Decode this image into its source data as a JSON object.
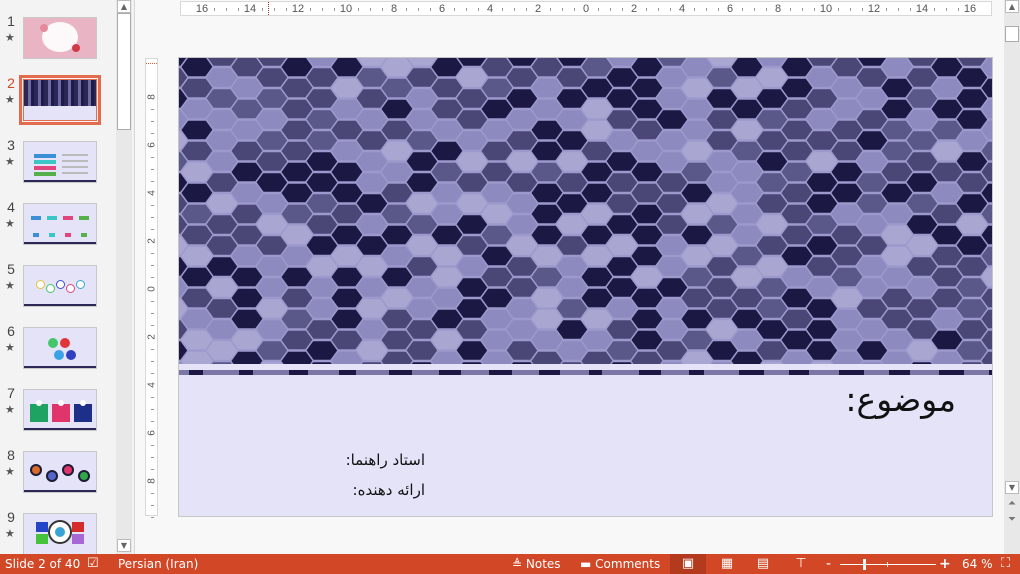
{
  "thumbnails": {
    "items": [
      {
        "number": "1",
        "bg": "#e9b4c3",
        "accent": "#ffffff",
        "kind": "floral"
      },
      {
        "number": "2",
        "bg": "#4a4777",
        "accent": "#e4e3f7",
        "kind": "hex",
        "active": true
      },
      {
        "number": "3",
        "bg": "#e4e3f7",
        "accent": "#3aa3d6",
        "kind": "list"
      },
      {
        "number": "4",
        "bg": "#e4e3f7",
        "accent": "#3aa3d6",
        "kind": "columns"
      },
      {
        "number": "5",
        "bg": "#e4e3f7",
        "accent": "#e3c13b",
        "kind": "circles"
      },
      {
        "number": "6",
        "bg": "#e4e3f7",
        "accent": "#44c76b",
        "kind": "hexes"
      },
      {
        "number": "7",
        "bg": "#e4e3f7",
        "accent": "#1ea363",
        "kind": "cards"
      },
      {
        "number": "8",
        "bg": "#e4e3f7",
        "accent": "#1d1b35",
        "kind": "wave"
      },
      {
        "number": "9",
        "bg": "#e4e3f7",
        "accent": "#2545c8",
        "kind": "target"
      }
    ],
    "star_icon": "★"
  },
  "ruler": {
    "horizontal_labels": [
      "16",
      "14",
      "12",
      "10",
      "8",
      "6",
      "4",
      "2",
      "0",
      "2",
      "4",
      "6",
      "8",
      "10",
      "12",
      "14",
      "16"
    ],
    "vertical_labels": [
      "8",
      "6",
      "4",
      "2",
      "0",
      "2",
      "4",
      "6",
      "8"
    ]
  },
  "slide": {
    "title": "موضوع:",
    "advisor_label": "استاد راهنما:",
    "presenter_label": "ارائه دهنده:",
    "colors": {
      "dark": "#1b1843",
      "mid": "#4a4777",
      "light": "#8d8ac0",
      "lighter": "#a9a6d2",
      "background": "#e4e3f7"
    }
  },
  "status_bar": {
    "slide_indicator": "Slide 2 of 40",
    "language": "Persian (Iran)",
    "notes_label": "Notes",
    "comments_label": "Comments",
    "zoom_level": "64 %",
    "zoom_fraction": 0.5,
    "color": "#d24726"
  }
}
